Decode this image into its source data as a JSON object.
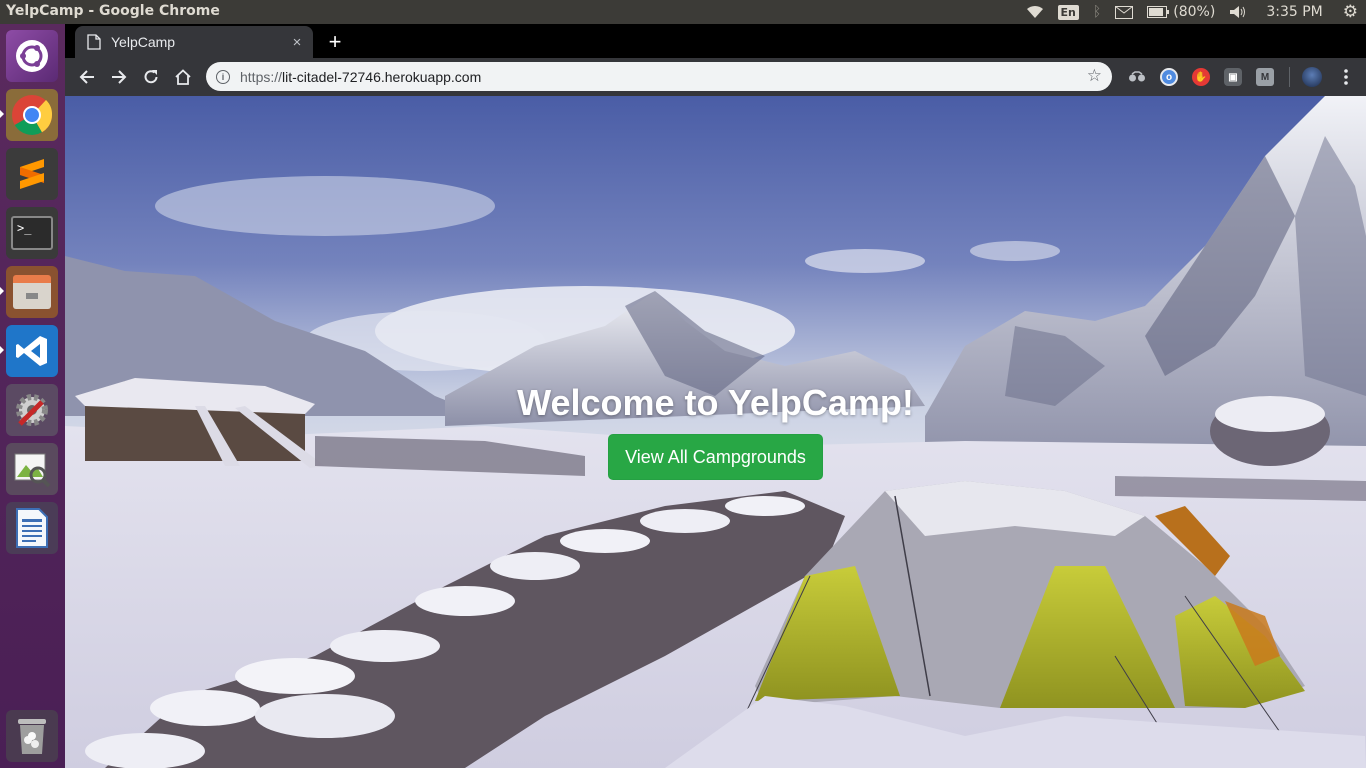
{
  "os": {
    "window_title": "YelpCamp - Google Chrome",
    "tray": {
      "keyboard_layout": "En",
      "battery": "(80%)",
      "clock": "3:35 PM"
    },
    "launcher_items": [
      {
        "name": "ubuntu-dash-icon"
      },
      {
        "name": "chrome-icon"
      },
      {
        "name": "sublime-text-icon"
      },
      {
        "name": "terminal-icon"
      },
      {
        "name": "files-icon"
      },
      {
        "name": "vscode-icon"
      },
      {
        "name": "system-settings-icon"
      },
      {
        "name": "image-viewer-icon"
      },
      {
        "name": "libreoffice-writer-icon"
      },
      {
        "name": "trash-icon"
      }
    ]
  },
  "browser": {
    "tab_title": "YelpCamp",
    "url_scheme": "https://",
    "url_host": "lit-citadel-72746.herokuapp.com",
    "new_tab_label": "+",
    "close_tab_label": "×"
  },
  "page": {
    "heading": "Welcome to YelpCamp!",
    "cta_label": "View All Campgrounds",
    "accent": "#28a745"
  }
}
